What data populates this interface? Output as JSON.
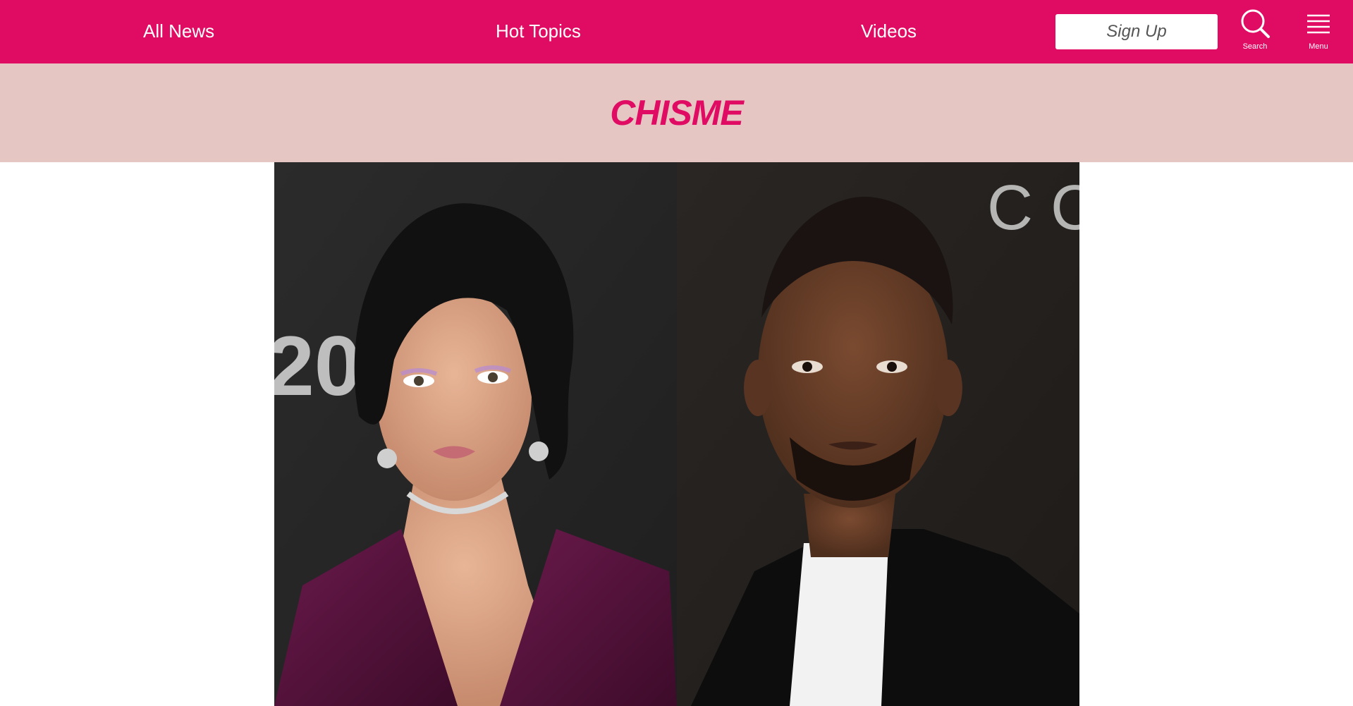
{
  "nav": {
    "links": [
      {
        "label": "All News"
      },
      {
        "label": "Hot Topics"
      },
      {
        "label": "Videos"
      }
    ],
    "signup_label": "Sign Up",
    "search_caption": "Search",
    "menu_caption": "Menu"
  },
  "section": {
    "title": "CHISME"
  },
  "colors": {
    "brand": "#e00b63",
    "section_background": "#e6c6c3",
    "page_background": "#ffffff"
  },
  "icons": {
    "search": "search-icon",
    "menu": "hamburger-menu-icon"
  }
}
